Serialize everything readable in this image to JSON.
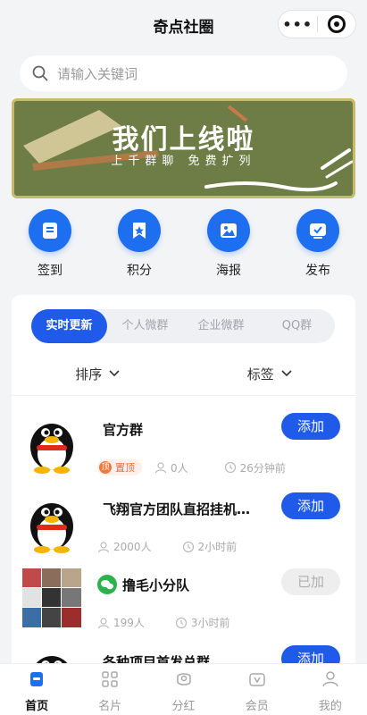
{
  "app": {
    "title": "奇点社圈",
    "more_glyph": "•••"
  },
  "search": {
    "placeholder": "请输入关键词"
  },
  "banner": {
    "headline": "我们上线啦",
    "sub": "上千群聊 免费扩列"
  },
  "quick_actions": [
    {
      "label": "签到",
      "icon": "checkin-icon"
    },
    {
      "label": "积分",
      "icon": "points-icon"
    },
    {
      "label": "海报",
      "icon": "poster-icon"
    },
    {
      "label": "发布",
      "icon": "publish-icon"
    }
  ],
  "tabs": [
    "实时更新",
    "个人微群",
    "企业微群",
    "QQ群"
  ],
  "active_tab": "实时更新",
  "filters": {
    "sort": "排序",
    "tags": "标签"
  },
  "groups": [
    {
      "name": "官方群",
      "pinned_label": "置顶",
      "pin_glyph": "顶",
      "members": "0人",
      "time": "26分钟前",
      "button": "添加",
      "joined": false,
      "type": "qq"
    },
    {
      "name": "飞翔官方团队直招挂机…",
      "members": "2000人",
      "time": "2小时前",
      "button": "添加",
      "joined": false,
      "type": "qq"
    },
    {
      "name": "撸毛小分队",
      "members": "199人",
      "time": "3小时前",
      "button": "已加",
      "joined": true,
      "type": "wechat"
    },
    {
      "name": "各种项目首发总群",
      "button": "添加",
      "joined": false,
      "type": "qq"
    }
  ],
  "tabbar": [
    {
      "label": "首页",
      "active": true
    },
    {
      "label": "名片",
      "active": false
    },
    {
      "label": "分红",
      "active": false
    },
    {
      "label": "会员",
      "active": false
    },
    {
      "label": "我的",
      "active": false
    }
  ],
  "colors": {
    "accent": "#1f5ae8",
    "icon_blue": "#1e6ff0",
    "banner_green": "#6e7c45",
    "pin_orange": "#f27a3c"
  }
}
